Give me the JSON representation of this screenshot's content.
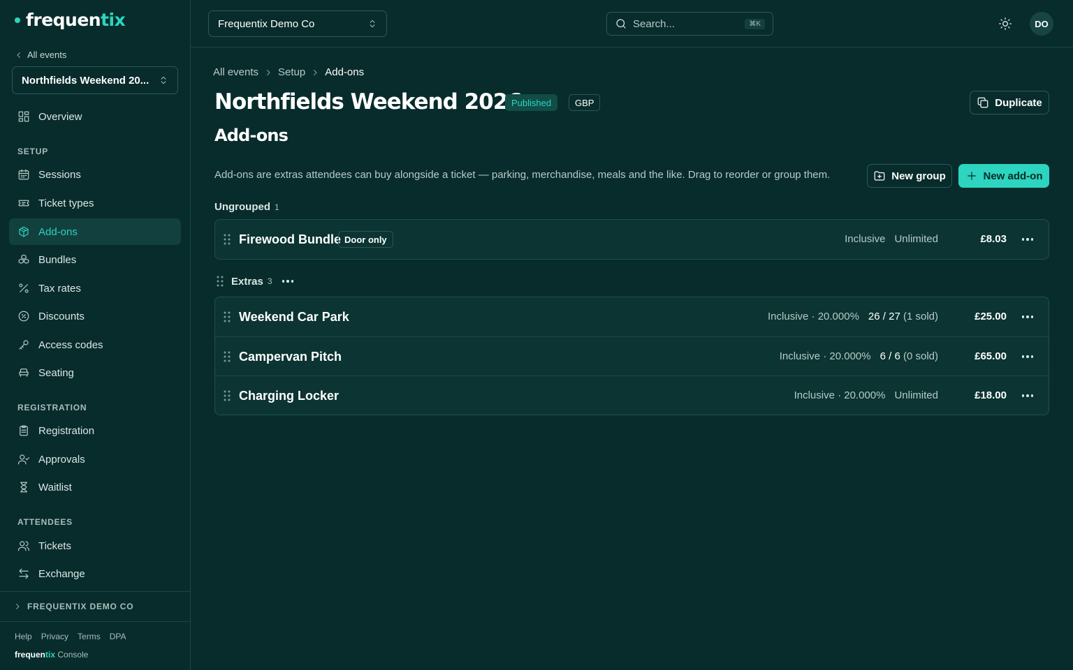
{
  "brand": {
    "name_left": "frequen",
    "name_right": "tix",
    "accent": "#2dd4bf",
    "background": "#072c2b"
  },
  "sidebar": {
    "back_label": "All events",
    "event_selector": "Northfields Weekend 20...",
    "overview": "Overview",
    "sections": [
      {
        "title": "SETUP",
        "items": [
          "Sessions",
          "Ticket types",
          "Add-ons",
          "Bundles",
          "Tax rates",
          "Discounts",
          "Access codes",
          "Seating"
        ]
      },
      {
        "title": "REGISTRATION",
        "items": [
          "Registration",
          "Approvals",
          "Waitlist"
        ]
      },
      {
        "title": "ATTENDEES",
        "items": [
          "Tickets",
          "Exchange"
        ]
      }
    ],
    "active_item": "Add-ons",
    "org_toggle": "FREQUENTIX DEMO CO",
    "footer_links": [
      "Help",
      "Privacy",
      "Terms",
      "DPA"
    ],
    "footer_brand_left": "frequen",
    "footer_brand_right": "tix",
    "footer_brand_suffix": "Console"
  },
  "topbar": {
    "org_selector": "Frequentix Demo Co",
    "search_placeholder": "Search...",
    "search_shortcut": "⌘K",
    "avatar_initials": "DO"
  },
  "breadcrumb": [
    "All events",
    "Setup",
    "Add-ons"
  ],
  "page": {
    "title": "Northfields Weekend 2026",
    "status_badge": "Published",
    "currency_badge": "GBP",
    "duplicate_label": "Duplicate",
    "section_title": "Add-ons",
    "description": "Add-ons are extras attendees can buy alongside a ticket — parking, merchandise, meals and the like. Drag to reorder or group them.",
    "new_group_label": "New group",
    "new_addon_label": "New add-on"
  },
  "groups": [
    {
      "name": "Ungrouped",
      "count": "1",
      "items": [
        {
          "name": "Firewood Bundle",
          "tag": "Door only",
          "tax": "Inclusive",
          "stock": "Unlimited",
          "price": "£8.03"
        }
      ]
    },
    {
      "name": "Extras",
      "count": "3",
      "items": [
        {
          "name": "Weekend Car Park",
          "tax": "Inclusive · 20.000%",
          "stock_bold": "26 / 27",
          "stock_sold": "(1 sold)",
          "price": "£25.00"
        },
        {
          "name": "Campervan Pitch",
          "tax": "Inclusive · 20.000%",
          "stock_bold": "6 / 6",
          "stock_sold": "(0 sold)",
          "price": "£65.00"
        },
        {
          "name": "Charging Locker",
          "tax": "Inclusive · 20.000%",
          "stock": "Unlimited",
          "price": "£18.00"
        }
      ]
    }
  ]
}
